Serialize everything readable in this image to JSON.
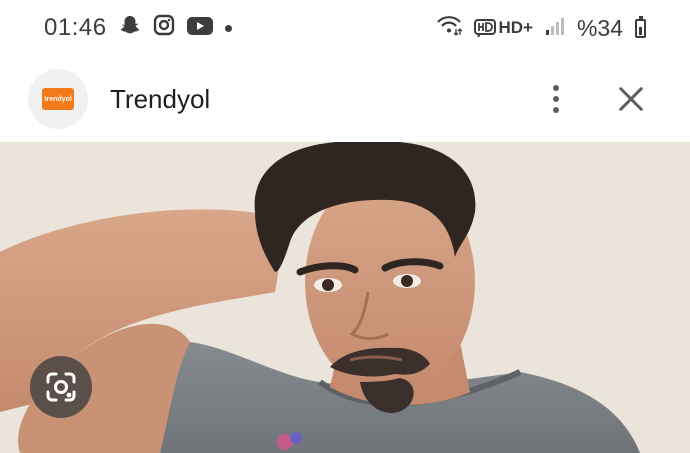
{
  "status_bar": {
    "time": "01:46",
    "left_icons": [
      "snapchat-icon",
      "instagram-icon",
      "youtube-icon",
      "notification-dot"
    ],
    "network_label": "HD+",
    "battery_text": "%34",
    "battery_level": 0.34
  },
  "header": {
    "logo_text": "trendyol",
    "title": "Trendyol",
    "icons": [
      "more-vert-icon",
      "close-icon"
    ]
  },
  "colors": {
    "brand": "#f27a1a",
    "text": "#1f1f1f",
    "icon": "#5f5f5f"
  },
  "image": {
    "lens_icon": "google-lens-icon"
  }
}
